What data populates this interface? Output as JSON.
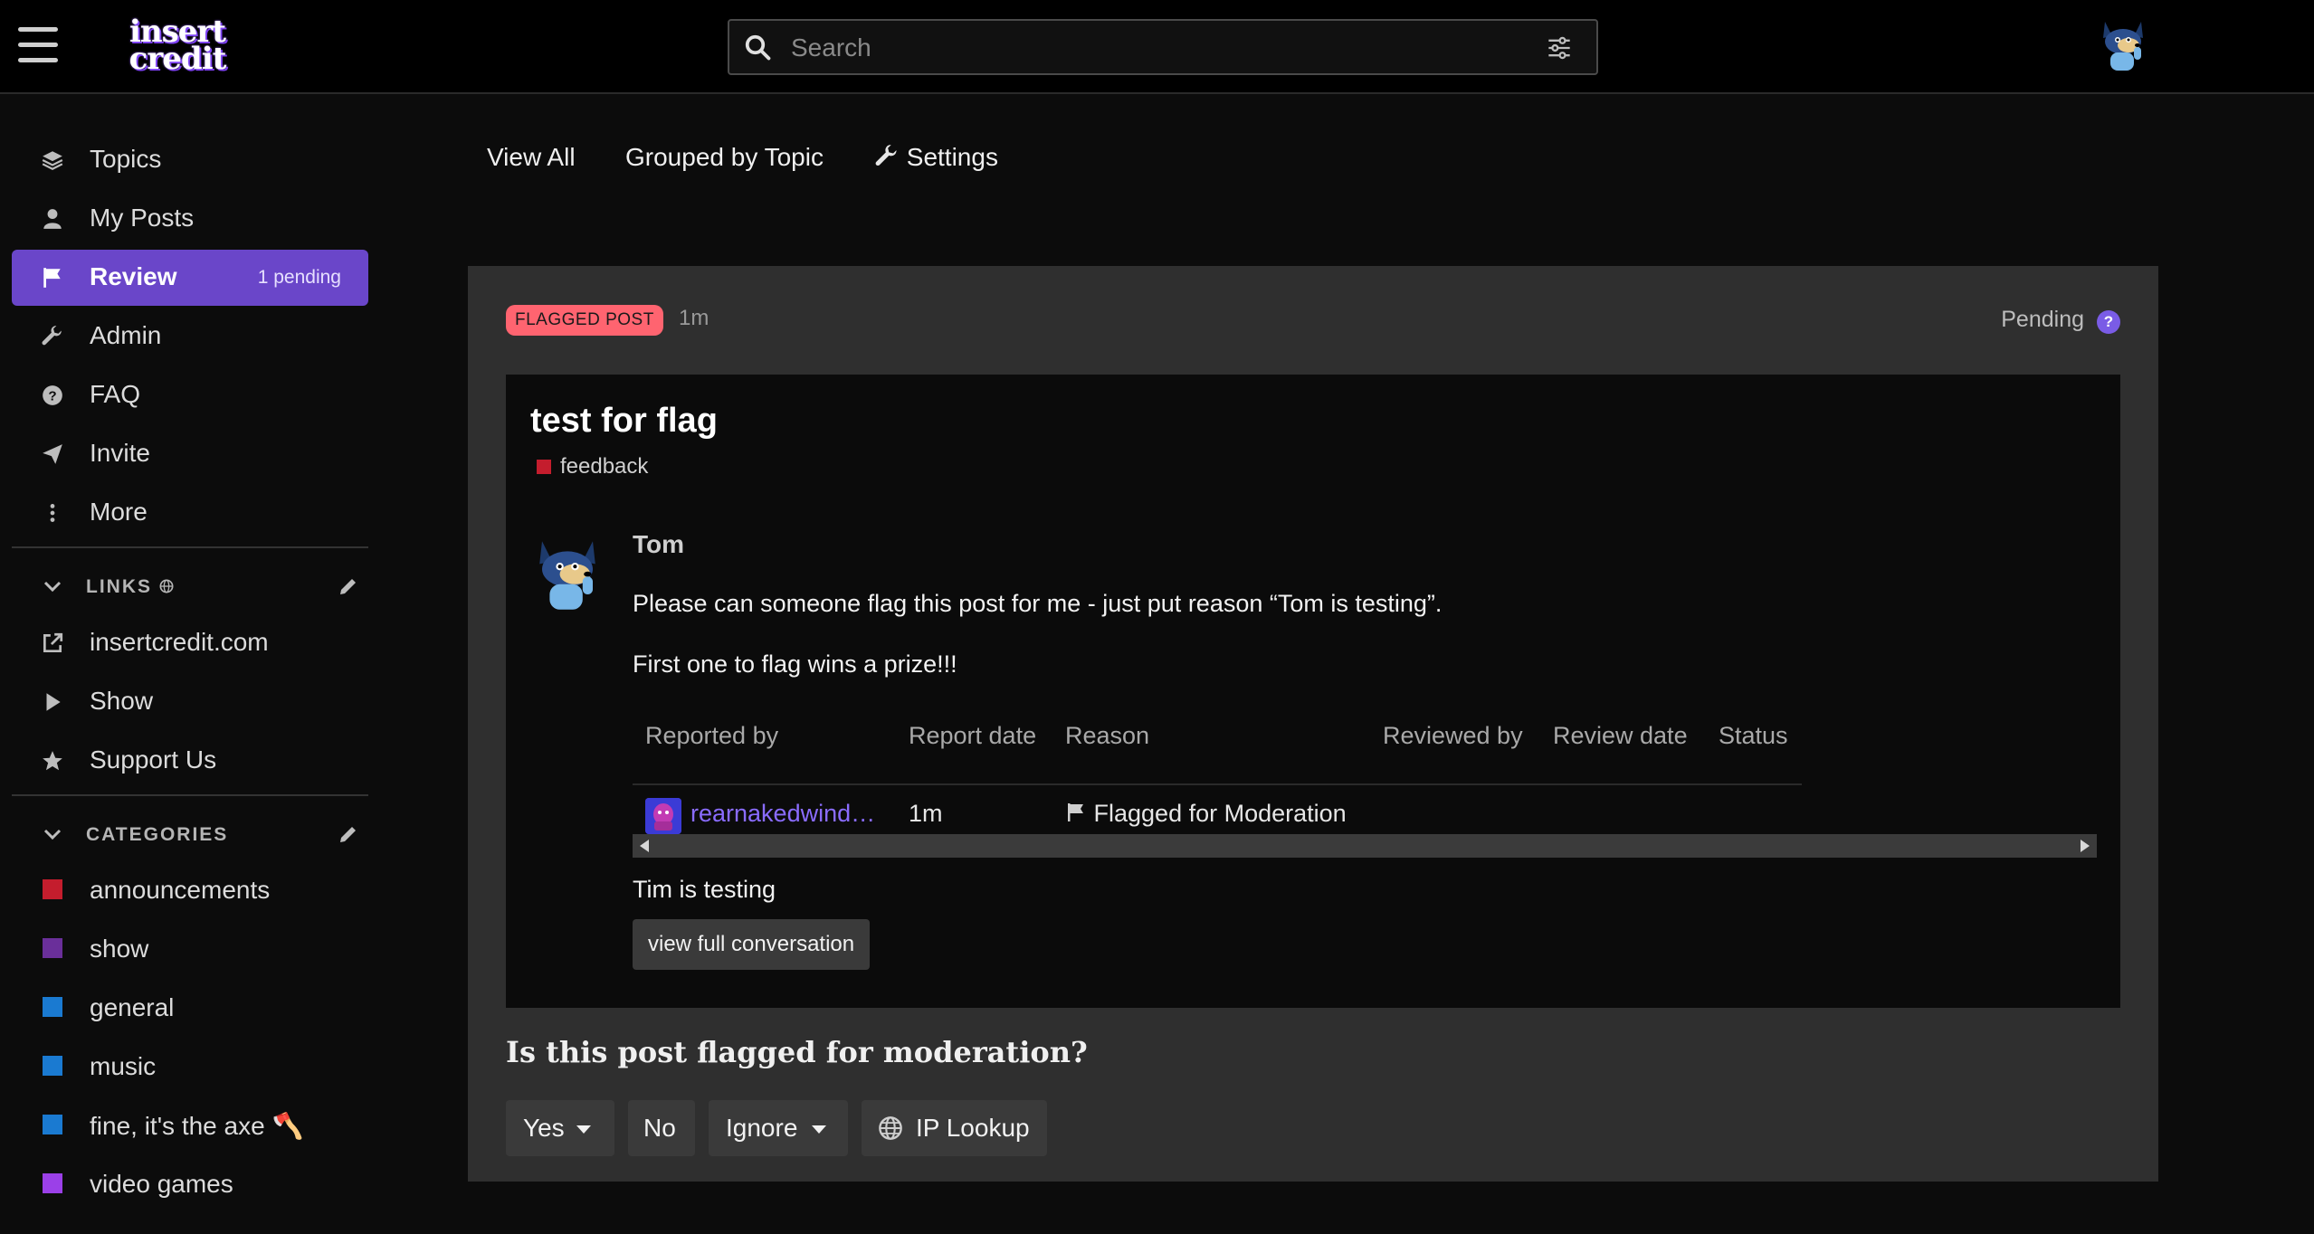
{
  "header": {
    "logo_line1": "insert",
    "logo_line2": "credit",
    "search_placeholder": "Search"
  },
  "sidebar": {
    "nav": [
      {
        "label": "Topics",
        "icon": "layers-icon"
      },
      {
        "label": "My Posts",
        "icon": "user-icon"
      },
      {
        "label": "Review",
        "icon": "flag-icon",
        "badge": "1 pending",
        "active": true
      },
      {
        "label": "Admin",
        "icon": "wrench-icon"
      },
      {
        "label": "FAQ",
        "icon": "question-circle-icon"
      },
      {
        "label": "Invite",
        "icon": "paper-plane-icon"
      },
      {
        "label": "More",
        "icon": "vertical-ellipsis-icon"
      }
    ],
    "links_heading": "LINKS",
    "links": [
      {
        "label": "insertcredit.com",
        "icon": "external-link-icon"
      },
      {
        "label": "Show",
        "icon": "play-icon"
      },
      {
        "label": "Support Us",
        "icon": "star-icon"
      }
    ],
    "categories_heading": "CATEGORIES",
    "categories": [
      {
        "label": "announcements",
        "color": "#c41d2d"
      },
      {
        "label": "show",
        "color": "#6a2f9a"
      },
      {
        "label": "general",
        "color": "#1a7ad1"
      },
      {
        "label": "music",
        "color": "#1a7ad1"
      },
      {
        "label": "fine, it's the axe 🪓",
        "color": "#1a7ad1"
      },
      {
        "label": "video games",
        "color": "#9b40e8"
      }
    ]
  },
  "topnav": {
    "view_all": "View All",
    "grouped": "Grouped by Topic",
    "settings": "Settings"
  },
  "review": {
    "type_badge": "FLAGGED POST",
    "age": "1m",
    "status": "Pending",
    "status_help": "?",
    "post": {
      "title": "test for flag",
      "category": "feedback",
      "category_color": "#c41d2d",
      "author": "Tom",
      "body_line1": "Please can someone flag this post for me - just put reason “Tom is testing”.",
      "body_line2": "First one to flag wins a prize!!!"
    },
    "table": {
      "headers": [
        "Reported by",
        "Report date",
        "Reason",
        "Reviewed by",
        "Review date",
        "Status"
      ],
      "row": {
        "reporter": "rearnakedwind…",
        "date": "1m",
        "reason": "Flagged for Moderation",
        "reporter_color": "#8a6cff"
      }
    },
    "flag_reason": "Tim is testing",
    "view_conversation": "view full conversation",
    "question": "Is this post flagged for moderation?",
    "actions": {
      "yes": "Yes",
      "no": "No",
      "ignore": "Ignore",
      "ip_lookup": "IP Lookup"
    }
  }
}
